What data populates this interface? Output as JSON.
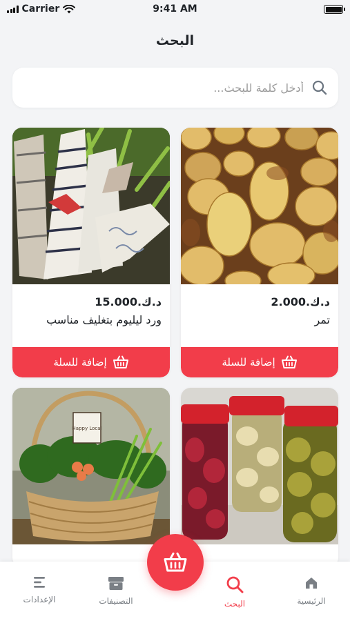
{
  "status_bar": {
    "carrier": "Carrier",
    "time": "9:41 AM"
  },
  "header": {
    "title": "البحث"
  },
  "search": {
    "placeholder": "أدخل كلمة للبحث..."
  },
  "products": [
    {
      "price": "د.ك.2.000",
      "name": "تمر",
      "add_label": "إضافة للسلة"
    },
    {
      "price": "د.ك.15.000",
      "name": "ورد ليليوم بتغليف مناسب",
      "add_label": "إضافة للسلة"
    },
    {
      "price": "",
      "name": "",
      "add_label": ""
    },
    {
      "price": "",
      "name": "",
      "add_label": ""
    }
  ],
  "basket_sign_text": "Happy Local",
  "tabs": [
    {
      "label": "الرئيسية",
      "icon": "home-icon"
    },
    {
      "label": "البحث",
      "icon": "search-icon",
      "active": true
    },
    {
      "label": "التصنيفات",
      "icon": "categories-icon"
    },
    {
      "label": "الإعدادات",
      "icon": "settings-icon"
    }
  ],
  "colors": {
    "accent": "#f23d4a",
    "background": "#f3f4f6",
    "card": "#ffffff"
  }
}
